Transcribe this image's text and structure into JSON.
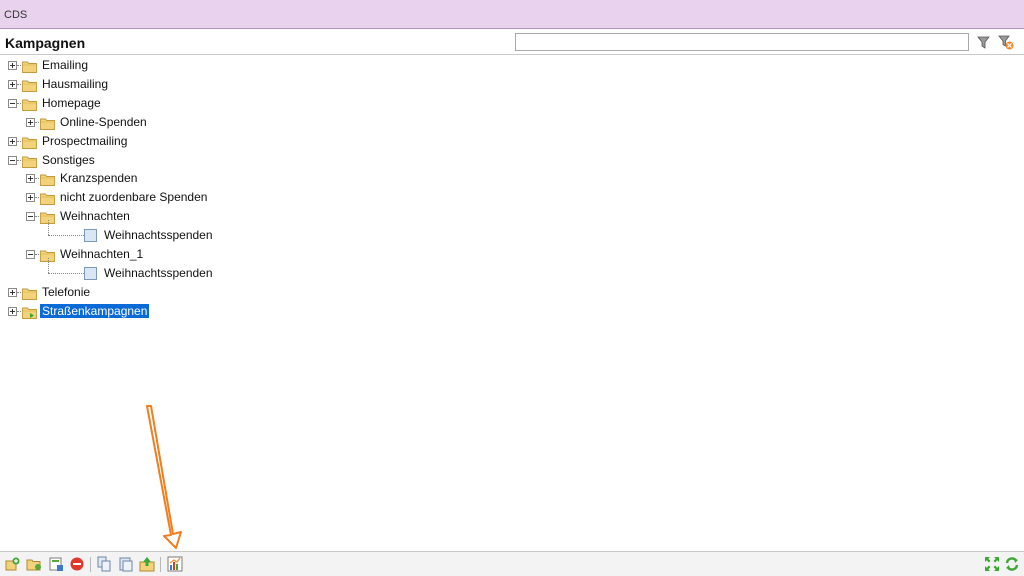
{
  "window": {
    "title": "CDS"
  },
  "header": {
    "title": "Kampagnen",
    "search_value": "",
    "filter_icon": "filter-icon",
    "clear_filter_icon": "clear-filter-icon"
  },
  "tree": {
    "nodes": [
      {
        "label": "Emailing",
        "level": 0,
        "type": "folder",
        "state": "collapsed"
      },
      {
        "label": "Hausmailing",
        "level": 0,
        "type": "folder",
        "state": "collapsed"
      },
      {
        "label": "Homepage",
        "level": 0,
        "type": "folder",
        "state": "expanded"
      },
      {
        "label": "Online-Spenden",
        "level": 1,
        "type": "folder",
        "state": "collapsed"
      },
      {
        "label": "Prospectmailing",
        "level": 0,
        "type": "folder",
        "state": "collapsed"
      },
      {
        "label": "Sonstiges",
        "level": 0,
        "type": "folder",
        "state": "expanded"
      },
      {
        "label": "Kranzspenden",
        "level": 1,
        "type": "folder",
        "state": "collapsed"
      },
      {
        "label": "nicht zuordenbare Spenden",
        "level": 1,
        "type": "folder",
        "state": "collapsed"
      },
      {
        "label": "Weihnachten",
        "level": 1,
        "type": "folder",
        "state": "expanded"
      },
      {
        "label": "Weihnachtsspenden",
        "level": 2,
        "type": "item",
        "state": "leaf"
      },
      {
        "label": "Weihnachten_1",
        "level": 1,
        "type": "folder",
        "state": "expanded"
      },
      {
        "label": "Weihnachtsspenden",
        "level": 2,
        "type": "item",
        "state": "leaf"
      },
      {
        "label": "Telefonie",
        "level": 0,
        "type": "folder",
        "state": "collapsed"
      },
      {
        "label": "Straßenkampagnen",
        "level": 0,
        "type": "folder-special",
        "state": "collapsed",
        "selected": true
      }
    ]
  },
  "toolbar": {
    "left_icons": [
      "new-campaign-icon",
      "new-folder-icon",
      "edit-icon",
      "delete-icon",
      "copy-icon",
      "paste-icon",
      "export-icon",
      "statistics-icon"
    ],
    "right_icons": [
      "expand-all-icon",
      "refresh-icon"
    ]
  },
  "annotation": {
    "type": "arrow",
    "color": "#f07d1e",
    "points_to": "statistics-icon"
  },
  "colors": {
    "titlebar": "#e8d2ee",
    "selection": "#0a6ad6",
    "folder": "#f2d27a"
  }
}
